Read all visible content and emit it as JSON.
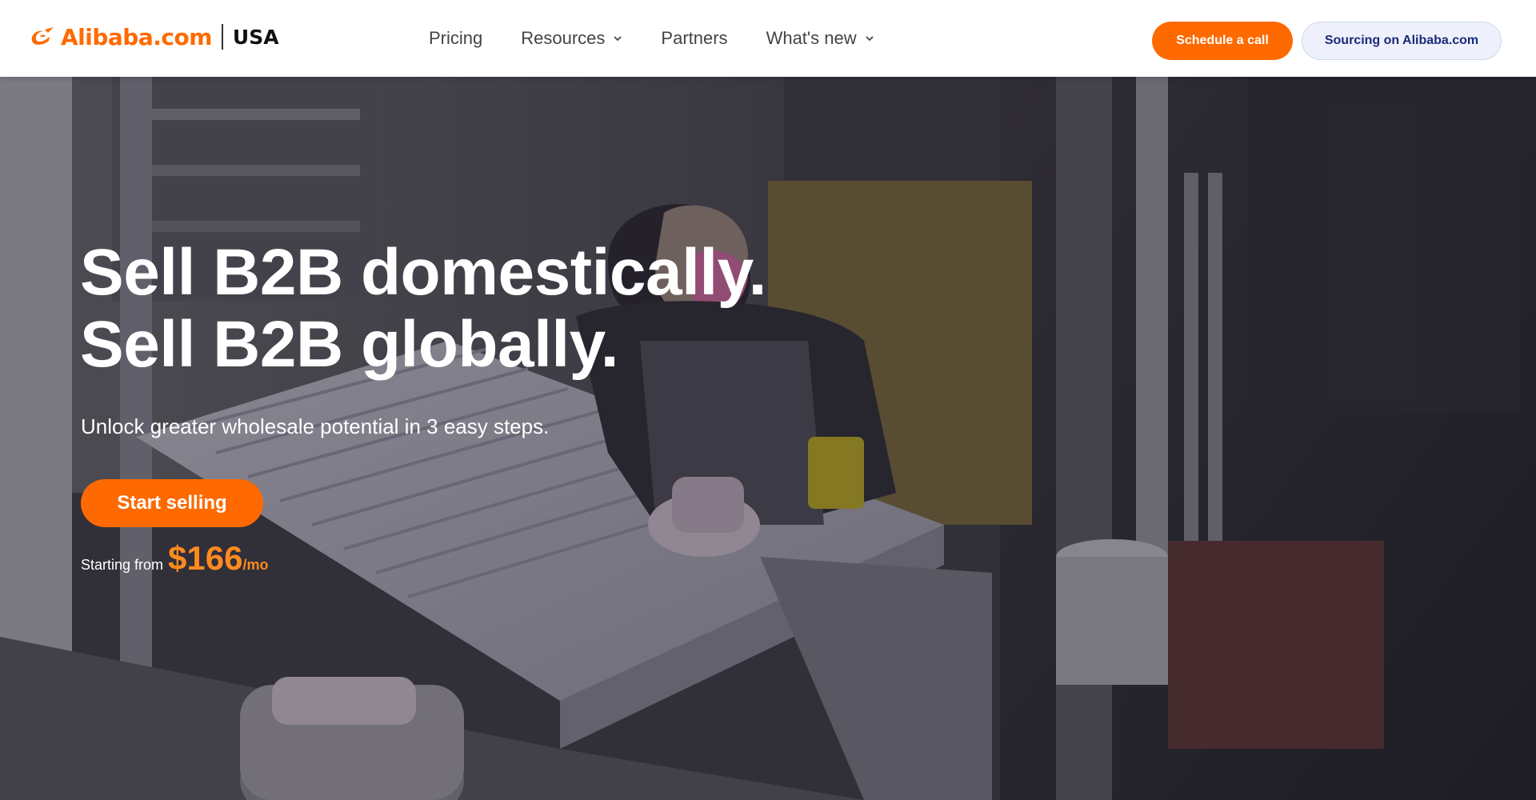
{
  "brand": {
    "name": "Alibaba.com",
    "region": "USA",
    "accent_color": "#ff6a00"
  },
  "nav": {
    "items": [
      {
        "label": "Pricing",
        "has_dropdown": false,
        "icon": null
      },
      {
        "label": "Resources",
        "has_dropdown": true,
        "icon": "chevron-down-icon"
      },
      {
        "label": "Partners",
        "has_dropdown": false,
        "icon": null
      },
      {
        "label": "What's new",
        "has_dropdown": true,
        "icon": "chevron-down-icon"
      }
    ]
  },
  "header_actions": {
    "schedule_label": "Schedule a call",
    "sourcing_label": "Sourcing on Alibaba.com"
  },
  "hero": {
    "headline_line1": "Sell B2B domestically.",
    "headline_line2": "Sell B2B globally.",
    "subheadline": "Unlock greater wholesale potential in 3 easy steps.",
    "cta_label": "Start selling",
    "pricing_prefix": "Starting from",
    "price": "$166",
    "price_unit": "/mo",
    "background_image": "worker-sanding-shutters-photo"
  }
}
